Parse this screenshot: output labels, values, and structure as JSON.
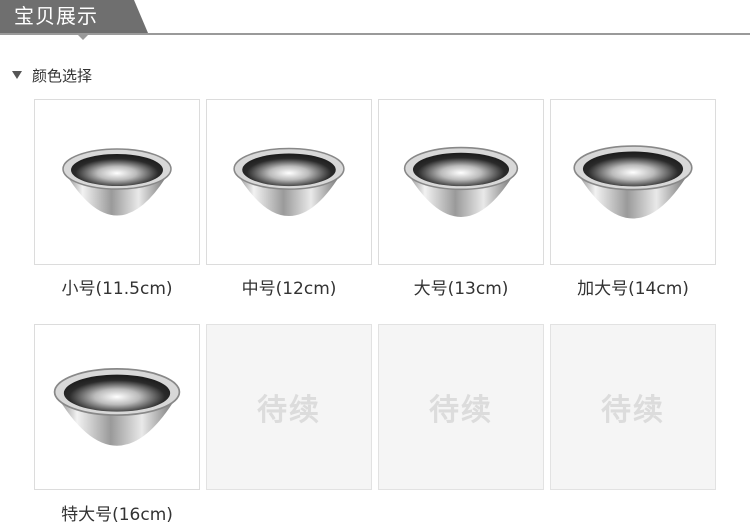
{
  "header": {
    "title": "宝贝展示"
  },
  "section": {
    "title": "颜色选择"
  },
  "items": [
    {
      "label": "小号(11.5cm)",
      "type": "bowl"
    },
    {
      "label": "中号(12cm)",
      "type": "bowl"
    },
    {
      "label": "大号(13cm)",
      "type": "bowl"
    },
    {
      "label": "加大号(14cm)",
      "type": "bowl"
    },
    {
      "label": "特大号(16cm)",
      "type": "bowl"
    },
    {
      "label": "待续",
      "type": "placeholder"
    },
    {
      "label": "待续",
      "type": "placeholder"
    },
    {
      "label": "待续",
      "type": "placeholder"
    }
  ],
  "colors": {
    "header_bg": "#6f6f6f",
    "header_line": "#9a9a9a",
    "placeholder_bg": "#f5f5f5",
    "placeholder_text": "#dcdcdc"
  }
}
